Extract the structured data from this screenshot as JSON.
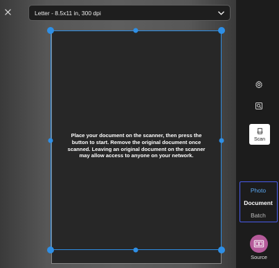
{
  "header": {
    "close_icon": "close-icon",
    "preset_value": "Letter - 8.5x11 in, 300 dpi",
    "preset_chevron_icon": "chevron-down-icon"
  },
  "preview": {
    "instructions": "Place your document on the scanner, then press the button to start. Remove the original document once scanned. Leaving an original document on the scanner may allow access to anyone on your network.",
    "crop_color": "#2e8fe6"
  },
  "side_panel": {
    "settings_icon": "gear-icon",
    "zoom_icon": "zoom-icon",
    "scan_label": "Scan",
    "modes": [
      {
        "label": "Photo",
        "state": "available"
      },
      {
        "label": "Document",
        "state": "selected"
      },
      {
        "label": "Batch",
        "state": "available"
      }
    ],
    "source_label": "Source",
    "source_color": "#b55a9a"
  }
}
